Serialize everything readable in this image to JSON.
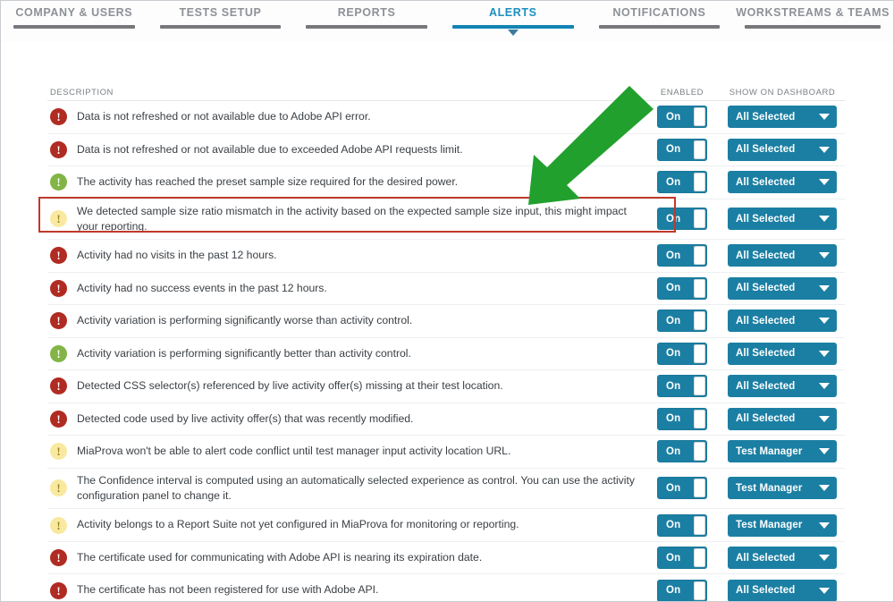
{
  "nav": {
    "tabs": [
      {
        "label": "COMPANY & USERS",
        "active": false
      },
      {
        "label": "TESTS SETUP",
        "active": false
      },
      {
        "label": "REPORTS",
        "active": false
      },
      {
        "label": "ALERTS",
        "active": true
      },
      {
        "label": "NOTIFICATIONS",
        "active": false
      },
      {
        "label": "WORKSTREAMS & TEAMS",
        "active": false
      }
    ]
  },
  "table": {
    "headers": {
      "description": "DESCRIPTION",
      "enabled": "ENABLED",
      "show_on_dashboard": "SHOW ON DASHBOARD"
    },
    "rows": [
      {
        "severity": "error",
        "icon": "error-exclamation-icon",
        "description": "Data is not refreshed or not available due to Adobe API error.",
        "enabled_label": "On",
        "enabled_state": "On",
        "dashboard_value": "All Selected",
        "highlighted": false
      },
      {
        "severity": "error",
        "icon": "error-exclamation-icon",
        "description": "Data is not refreshed or not available due to exceeded Adobe API requests limit.",
        "enabled_label": "On",
        "enabled_state": "On",
        "dashboard_value": "All Selected",
        "highlighted": false
      },
      {
        "severity": "success",
        "icon": "success-exclamation-icon",
        "description": "The activity has reached the preset sample size required for the desired power.",
        "enabled_label": "On",
        "enabled_state": "On",
        "dashboard_value": "All Selected",
        "highlighted": false
      },
      {
        "severity": "warning",
        "icon": "warning-exclamation-icon",
        "description": "We detected sample size ratio mismatch in the activity based on the expected sample size input, this might impact your reporting.",
        "enabled_label": "On",
        "enabled_state": "On",
        "dashboard_value": "All Selected",
        "highlighted": true
      },
      {
        "severity": "error",
        "icon": "error-exclamation-icon",
        "description": "Activity had no visits in the past 12 hours.",
        "enabled_label": "On",
        "enabled_state": "On",
        "dashboard_value": "All Selected",
        "highlighted": false
      },
      {
        "severity": "error",
        "icon": "error-exclamation-icon",
        "description": "Activity had no success events in the past 12 hours.",
        "enabled_label": "On",
        "enabled_state": "On",
        "dashboard_value": "All Selected",
        "highlighted": false
      },
      {
        "severity": "error",
        "icon": "error-exclamation-icon",
        "description": "Activity variation is performing significantly worse than activity control.",
        "enabled_label": "On",
        "enabled_state": "On",
        "dashboard_value": "All Selected",
        "highlighted": false
      },
      {
        "severity": "success",
        "icon": "success-exclamation-icon",
        "description": "Activity variation is performing significantly better than activity control.",
        "enabled_label": "On",
        "enabled_state": "On",
        "dashboard_value": "All Selected",
        "highlighted": false
      },
      {
        "severity": "error",
        "icon": "error-exclamation-icon",
        "description": "Detected CSS selector(s) referenced by live activity offer(s) missing at their test location.",
        "enabled_label": "On",
        "enabled_state": "On",
        "dashboard_value": "All Selected",
        "highlighted": false
      },
      {
        "severity": "error",
        "icon": "error-exclamation-icon",
        "description": "Detected code used by live activity offer(s) that was recently modified.",
        "enabled_label": "On",
        "enabled_state": "On",
        "dashboard_value": "All Selected",
        "highlighted": false
      },
      {
        "severity": "warning",
        "icon": "warning-exclamation-icon",
        "description": "MiaProva won't be able to alert code conflict until test manager input activity location URL.",
        "enabled_label": "On",
        "enabled_state": "On",
        "dashboard_value": "Test Manager",
        "highlighted": false
      },
      {
        "severity": "warning",
        "icon": "warning-exclamation-icon",
        "description": "The Confidence interval is computed using an automatically selected experience as control. You can use the activity configuration panel to change it.",
        "enabled_label": "On",
        "enabled_state": "On",
        "dashboard_value": "Test Manager",
        "highlighted": false
      },
      {
        "severity": "warning",
        "icon": "warning-exclamation-icon",
        "description": "Activity belongs to a Report Suite not yet configured in MiaProva for monitoring or reporting.",
        "enabled_label": "On",
        "enabled_state": "On",
        "dashboard_value": "Test Manager",
        "highlighted": false
      },
      {
        "severity": "error",
        "icon": "error-exclamation-icon",
        "description": "The certificate used for communicating with Adobe API is nearing its expiration date.",
        "enabled_label": "On",
        "enabled_state": "On",
        "dashboard_value": "All Selected",
        "highlighted": false
      },
      {
        "severity": "error",
        "icon": "error-exclamation-icon",
        "description": "The certificate has not been registered for use with Adobe API.",
        "enabled_label": "On",
        "enabled_state": "On",
        "dashboard_value": "All Selected",
        "highlighted": false
      }
    ]
  },
  "annotations": {
    "arrow": {
      "name": "green-arrow-annotation",
      "color": "#22a02e"
    },
    "highlight": {
      "name": "red-highlight-box",
      "color": "#c0392b"
    }
  },
  "colors": {
    "accent_blue": "#1b7fa3",
    "tab_active": "#1a8fc1",
    "severity_error": "#b02b22",
    "severity_success": "#82b446",
    "severity_warning": "#f9e9a0",
    "annotation_green": "#22a02e",
    "annotation_red": "#c0392b"
  }
}
